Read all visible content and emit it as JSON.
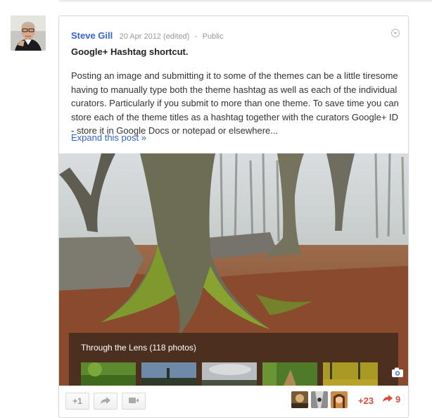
{
  "post": {
    "author": "Steve Gill",
    "date": "20 Apr 2012 (edited)",
    "separator": "-",
    "visibility": "Public",
    "title": "Google+ Hashtag shortcut.",
    "body": "Posting an image and submitting it to some of the themes can be a little tiresome having to manually type both the theme hashtag as well as each of the individual curators. Particularly if you submit to more than one theme. To save time you can store each of the theme titles as a hashtag together with the curators Google+ ID - store it in Google Docs or notepad or elsewhere...",
    "expand_label": "Expand this post »"
  },
  "album": {
    "title": "Through the Lens (118 photos)",
    "thumbnails": [
      "forest-green",
      "church-sky",
      "cloudy-sky",
      "green-path",
      "autumn-leaves"
    ]
  },
  "actions": {
    "plus_one_label": "+1",
    "share_icon": "share-arrow-icon",
    "hangout_icon": "video-camera-icon",
    "plus_count": "+23",
    "share_count": "9"
  },
  "colors": {
    "link": "#3366cc",
    "count": "#dd4b39"
  }
}
